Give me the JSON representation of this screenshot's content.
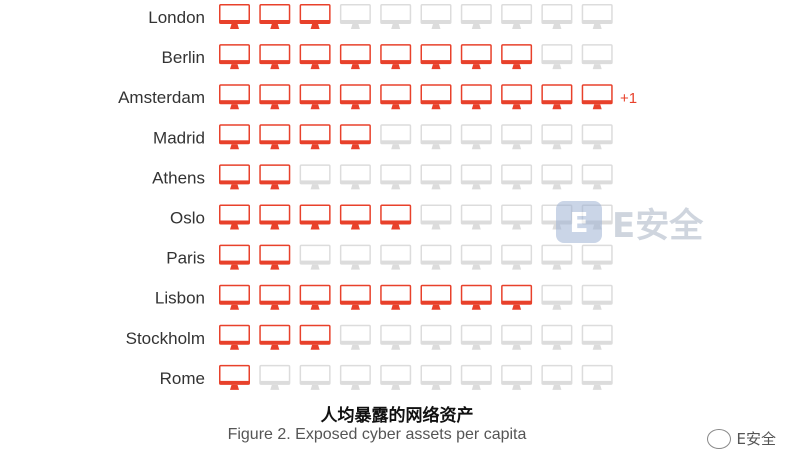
{
  "chart_data": {
    "type": "pictogram",
    "icon": "monitor-icon",
    "icons_per_row": 10,
    "categories": [
      "London",
      "Berlin",
      "Amsterdam",
      "Madrid",
      "Athens",
      "Oslo",
      "Paris",
      "Lisbon",
      "Stockholm",
      "Rome"
    ],
    "values": [
      3,
      8,
      10,
      4,
      2,
      5,
      2,
      8,
      3,
      1
    ],
    "extra": [
      {
        "category": "Amsterdam",
        "label": "+1"
      }
    ],
    "title": "人均暴露的网络资产",
    "caption": "Figure 2. Exposed cyber assets per capita"
  },
  "colors": {
    "filled": "#e8412b",
    "empty": "#dcdcdc",
    "label": "#333333",
    "extra_label": "#e8412b"
  },
  "watermark": {
    "badge": "E",
    "text": "E安全"
  },
  "footer": {
    "brand": "E安全"
  }
}
